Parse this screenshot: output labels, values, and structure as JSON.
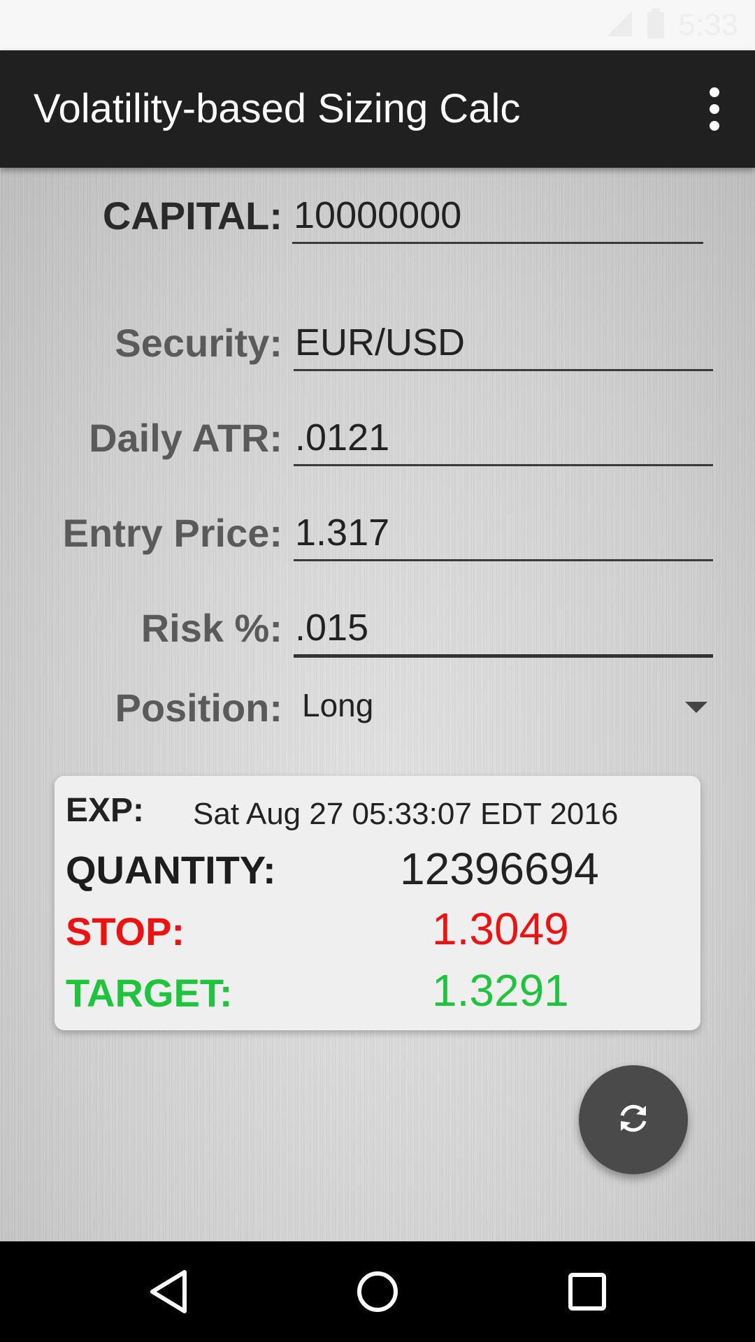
{
  "status_bar": {
    "network": "3G",
    "time": "5:33"
  },
  "app_bar": {
    "title": "Volatility-based Sizing Calc",
    "overflow_icon": "more-vert-icon"
  },
  "form": {
    "capital_label": "CAPITAL:",
    "capital_value": "10000000",
    "security_label": "Security:",
    "security_value": "EUR/USD",
    "atr_label": "Daily ATR:",
    "atr_value": ".0121",
    "entry_label": "Entry Price:",
    "entry_value": "1.317",
    "risk_label": "Risk %:",
    "risk_value": ".015",
    "position_label": "Position:",
    "position_value": "Long"
  },
  "results": {
    "exp_label": "EXP:",
    "exp_value": "Sat Aug 27 05:33:07 EDT 2016",
    "quantity_label": "QUANTITY:",
    "quantity_value": "12396694",
    "stop_label": "STOP:",
    "stop_value": "1.3049",
    "target_label": "TARGET:",
    "target_value": "1.3291"
  },
  "colors": {
    "stop": "#ee1111",
    "target": "#1ec43c",
    "app_bar": "#202020"
  },
  "fab": {
    "icon": "refresh-icon"
  },
  "nav": {
    "back": "back-icon",
    "home": "home-icon",
    "recents": "recents-icon"
  }
}
